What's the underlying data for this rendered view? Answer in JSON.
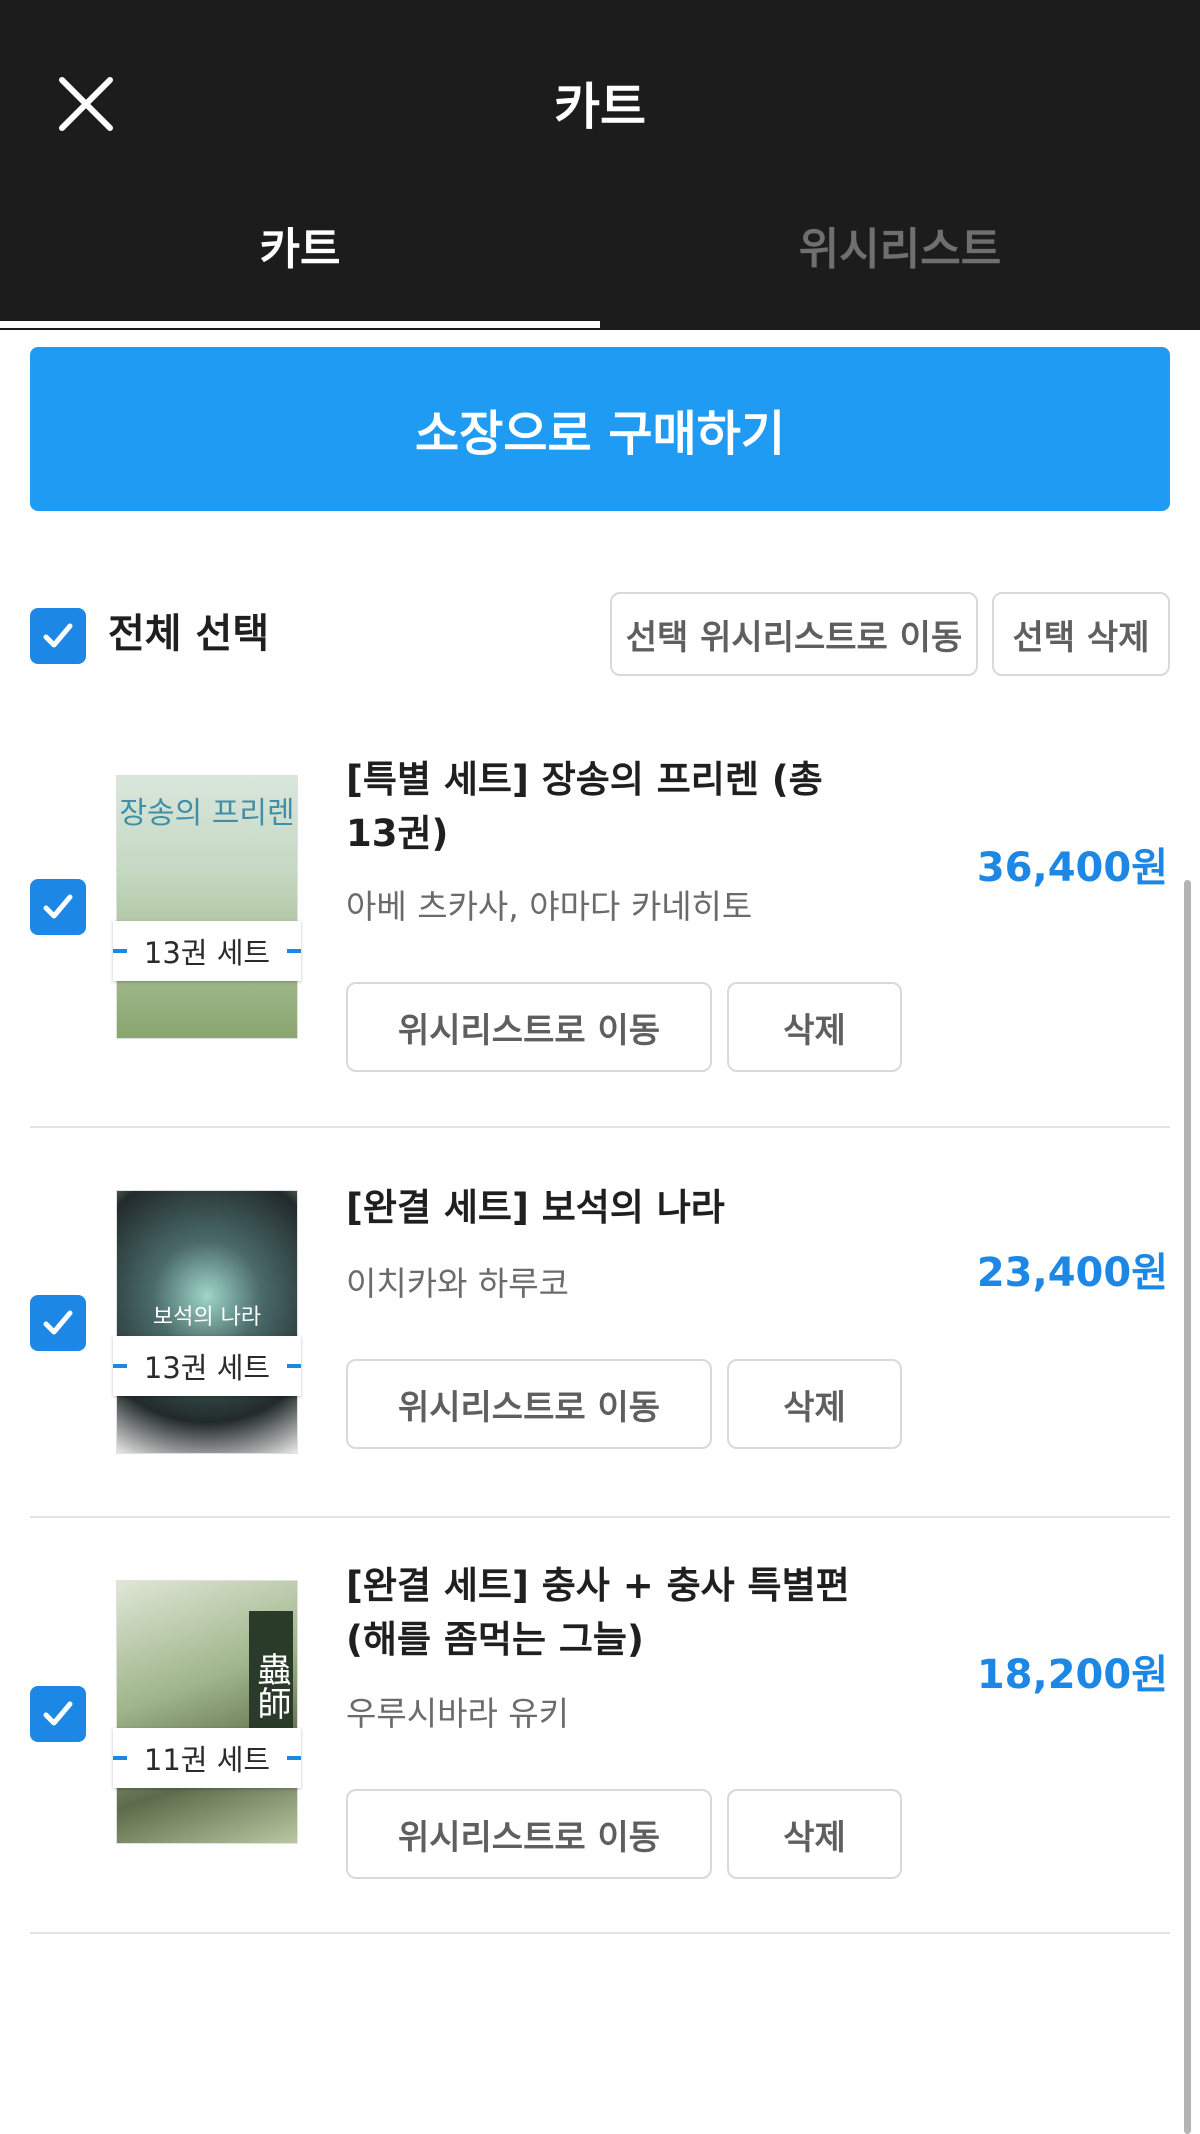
{
  "header": {
    "title": "카트",
    "close_icon": "close-icon"
  },
  "tabs": [
    {
      "label": "카트",
      "active": true
    },
    {
      "label": "위시리스트",
      "active": false
    }
  ],
  "buy_button": {
    "label": "소장으로 구매하기",
    "color": "#1f9bf3"
  },
  "toolbar": {
    "select_all_label": "전체 선택",
    "select_all_checked": true,
    "move_to_wishlist_label": "선택 위시리스트로 이동",
    "delete_selected_label": "선택 삭제"
  },
  "items": [
    {
      "checked": true,
      "title": "[특별 세트] 장송의 프리렌 (총 13권)",
      "author": "아베 츠카사, 야마다 카네히토",
      "price": "36,400원",
      "set_badge": "13권 세트",
      "cover_text": "장송의 프리렌",
      "wishlist_label": "위시리스트로 이동",
      "delete_label": "삭제"
    },
    {
      "checked": true,
      "title": "[완결 세트] 보석의 나라",
      "author": "이치카와 하루코",
      "price": "23,400원",
      "set_badge": "13권 세트",
      "cover_text": "보석의 나라",
      "wishlist_label": "위시리스트로 이동",
      "delete_label": "삭제"
    },
    {
      "checked": true,
      "title": "[완결 세트] 충사 + 충사 특별편(해를 좀먹는 그늘)",
      "author": "우루시바라 유키",
      "price": "18,200원",
      "set_badge": "11권 세트",
      "cover_text": "蟲師",
      "wishlist_label": "위시리스트로 이동",
      "delete_label": "삭제"
    }
  ],
  "colors": {
    "accent": "#1d87e6",
    "header_bg": "#1c1c1c",
    "price": "#1d87e6"
  }
}
